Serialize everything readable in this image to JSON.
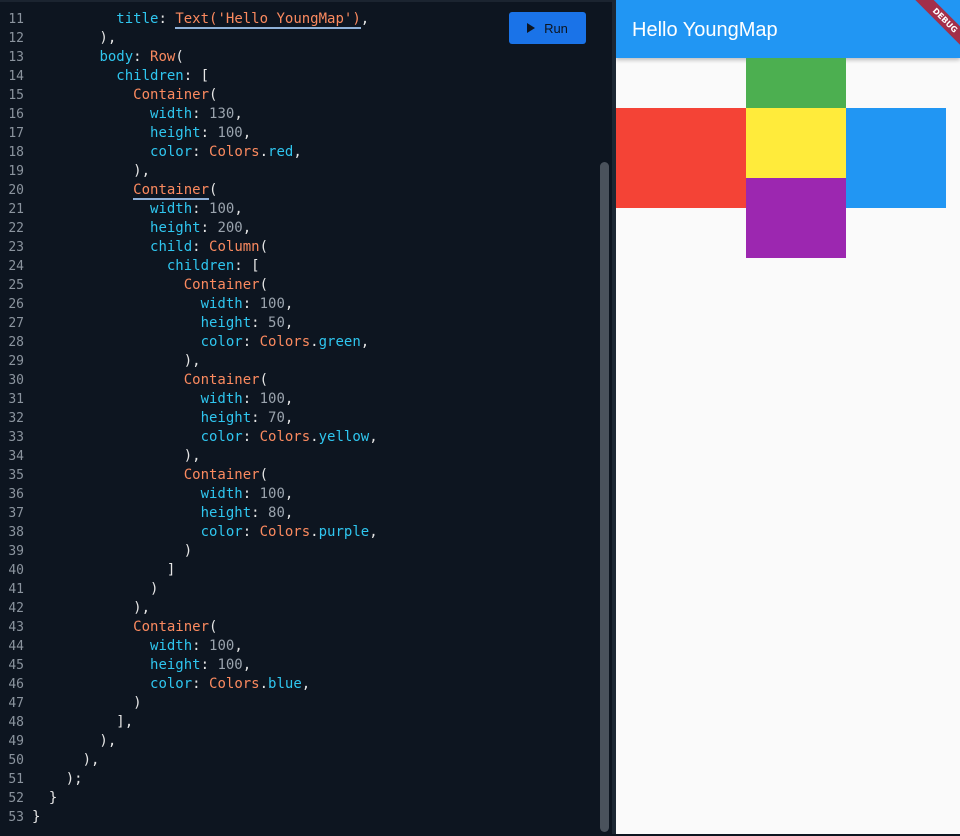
{
  "editor": {
    "run_label": "Run",
    "lines": [
      {
        "n": "11",
        "tokens": [
          [
            "          ",
            "t-id"
          ],
          [
            "title",
            "t-prop"
          ],
          [
            ": ",
            "t-punc"
          ],
          [
            "Text('Hello YoungMap')",
            "t-class"
          ],
          [
            ",",
            "t-punc"
          ]
        ]
      },
      {
        "n": "12",
        "tokens": [
          [
            "        ),",
            "t-punc"
          ]
        ]
      },
      {
        "n": "13",
        "tokens": [
          [
            "        ",
            "t-id"
          ],
          [
            "body",
            "t-prop"
          ],
          [
            ": ",
            "t-punc"
          ],
          [
            "Row",
            "t-class"
          ],
          [
            "(",
            "t-punc"
          ]
        ]
      },
      {
        "n": "14",
        "tokens": [
          [
            "          ",
            "t-id"
          ],
          [
            "children",
            "t-prop"
          ],
          [
            ": [",
            "t-punc"
          ]
        ]
      },
      {
        "n": "15",
        "tokens": [
          [
            "            ",
            "t-id"
          ],
          [
            "Container",
            "t-class"
          ],
          [
            "(",
            "t-punc"
          ]
        ]
      },
      {
        "n": "16",
        "tokens": [
          [
            "              ",
            "t-id"
          ],
          [
            "width",
            "t-prop"
          ],
          [
            ": ",
            "t-punc"
          ],
          [
            "130",
            "t-num"
          ],
          [
            ",",
            "t-punc"
          ]
        ]
      },
      {
        "n": "17",
        "tokens": [
          [
            "              ",
            "t-id"
          ],
          [
            "height",
            "t-prop"
          ],
          [
            ": ",
            "t-punc"
          ],
          [
            "100",
            "t-num"
          ],
          [
            ",",
            "t-punc"
          ]
        ]
      },
      {
        "n": "18",
        "tokens": [
          [
            "              ",
            "t-id"
          ],
          [
            "color",
            "t-prop"
          ],
          [
            ": ",
            "t-punc"
          ],
          [
            "Colors",
            "t-class"
          ],
          [
            ".",
            "t-punc"
          ],
          [
            "red",
            "t-prop"
          ],
          [
            ",",
            "t-punc"
          ]
        ]
      },
      {
        "n": "19",
        "tokens": [
          [
            "            ),",
            "t-punc"
          ]
        ]
      },
      {
        "n": "20",
        "tokens": [
          [
            "            ",
            "t-id"
          ],
          [
            "Container",
            "t-class"
          ],
          [
            "(",
            "t-punc"
          ]
        ]
      },
      {
        "n": "21",
        "tokens": [
          [
            "              ",
            "t-id"
          ],
          [
            "width",
            "t-prop"
          ],
          [
            ": ",
            "t-punc"
          ],
          [
            "100",
            "t-num"
          ],
          [
            ",",
            "t-punc"
          ]
        ]
      },
      {
        "n": "22",
        "tokens": [
          [
            "              ",
            "t-id"
          ],
          [
            "height",
            "t-prop"
          ],
          [
            ": ",
            "t-punc"
          ],
          [
            "200",
            "t-num"
          ],
          [
            ",",
            "t-punc"
          ]
        ]
      },
      {
        "n": "23",
        "tokens": [
          [
            "              ",
            "t-id"
          ],
          [
            "child",
            "t-prop"
          ],
          [
            ": ",
            "t-punc"
          ],
          [
            "Column",
            "t-class"
          ],
          [
            "(",
            "t-punc"
          ]
        ]
      },
      {
        "n": "24",
        "tokens": [
          [
            "                ",
            "t-id"
          ],
          [
            "children",
            "t-prop"
          ],
          [
            ": [",
            "t-punc"
          ]
        ]
      },
      {
        "n": "25",
        "tokens": [
          [
            "                  ",
            "t-id"
          ],
          [
            "Container",
            "t-class"
          ],
          [
            "(",
            "t-punc"
          ]
        ]
      },
      {
        "n": "26",
        "tokens": [
          [
            "                    ",
            "t-id"
          ],
          [
            "width",
            "t-prop"
          ],
          [
            ": ",
            "t-punc"
          ],
          [
            "100",
            "t-num"
          ],
          [
            ",",
            "t-punc"
          ]
        ]
      },
      {
        "n": "27",
        "tokens": [
          [
            "                    ",
            "t-id"
          ],
          [
            "height",
            "t-prop"
          ],
          [
            ": ",
            "t-punc"
          ],
          [
            "50",
            "t-num"
          ],
          [
            ",",
            "t-punc"
          ]
        ]
      },
      {
        "n": "28",
        "tokens": [
          [
            "                    ",
            "t-id"
          ],
          [
            "color",
            "t-prop"
          ],
          [
            ": ",
            "t-punc"
          ],
          [
            "Colors",
            "t-class"
          ],
          [
            ".",
            "t-punc"
          ],
          [
            "green",
            "t-prop"
          ],
          [
            ",",
            "t-punc"
          ]
        ]
      },
      {
        "n": "29",
        "tokens": [
          [
            "                  ),",
            "t-punc"
          ]
        ]
      },
      {
        "n": "30",
        "tokens": [
          [
            "                  ",
            "t-id"
          ],
          [
            "Container",
            "t-class"
          ],
          [
            "(",
            "t-punc"
          ]
        ]
      },
      {
        "n": "31",
        "tokens": [
          [
            "                    ",
            "t-id"
          ],
          [
            "width",
            "t-prop"
          ],
          [
            ": ",
            "t-punc"
          ],
          [
            "100",
            "t-num"
          ],
          [
            ",",
            "t-punc"
          ]
        ]
      },
      {
        "n": "32",
        "tokens": [
          [
            "                    ",
            "t-id"
          ],
          [
            "height",
            "t-prop"
          ],
          [
            ": ",
            "t-punc"
          ],
          [
            "70",
            "t-num"
          ],
          [
            ",",
            "t-punc"
          ]
        ]
      },
      {
        "n": "33",
        "tokens": [
          [
            "                    ",
            "t-id"
          ],
          [
            "color",
            "t-prop"
          ],
          [
            ": ",
            "t-punc"
          ],
          [
            "Colors",
            "t-class"
          ],
          [
            ".",
            "t-punc"
          ],
          [
            "yellow",
            "t-prop"
          ],
          [
            ",",
            "t-punc"
          ]
        ]
      },
      {
        "n": "34",
        "tokens": [
          [
            "                  ),",
            "t-punc"
          ]
        ]
      },
      {
        "n": "35",
        "tokens": [
          [
            "                  ",
            "t-id"
          ],
          [
            "Container",
            "t-class"
          ],
          [
            "(",
            "t-punc"
          ]
        ]
      },
      {
        "n": "36",
        "tokens": [
          [
            "                    ",
            "t-id"
          ],
          [
            "width",
            "t-prop"
          ],
          [
            ": ",
            "t-punc"
          ],
          [
            "100",
            "t-num"
          ],
          [
            ",",
            "t-punc"
          ]
        ]
      },
      {
        "n": "37",
        "tokens": [
          [
            "                    ",
            "t-id"
          ],
          [
            "height",
            "t-prop"
          ],
          [
            ": ",
            "t-punc"
          ],
          [
            "80",
            "t-num"
          ],
          [
            ",",
            "t-punc"
          ]
        ]
      },
      {
        "n": "38",
        "tokens": [
          [
            "                    ",
            "t-id"
          ],
          [
            "color",
            "t-prop"
          ],
          [
            ": ",
            "t-punc"
          ],
          [
            "Colors",
            "t-class"
          ],
          [
            ".",
            "t-punc"
          ],
          [
            "purple",
            "t-prop"
          ],
          [
            ",",
            "t-punc"
          ]
        ]
      },
      {
        "n": "39",
        "tokens": [
          [
            "                  )",
            "t-punc"
          ]
        ]
      },
      {
        "n": "40",
        "tokens": [
          [
            "                ]",
            "t-punc"
          ]
        ]
      },
      {
        "n": "41",
        "tokens": [
          [
            "              )",
            "t-punc"
          ]
        ]
      },
      {
        "n": "42",
        "tokens": [
          [
            "            ),",
            "t-punc"
          ]
        ]
      },
      {
        "n": "43",
        "tokens": [
          [
            "            ",
            "t-id"
          ],
          [
            "Container",
            "t-class"
          ],
          [
            "(",
            "t-punc"
          ]
        ]
      },
      {
        "n": "44",
        "tokens": [
          [
            "              ",
            "t-id"
          ],
          [
            "width",
            "t-prop"
          ],
          [
            ": ",
            "t-punc"
          ],
          [
            "100",
            "t-num"
          ],
          [
            ",",
            "t-punc"
          ]
        ]
      },
      {
        "n": "45",
        "tokens": [
          [
            "              ",
            "t-id"
          ],
          [
            "height",
            "t-prop"
          ],
          [
            ": ",
            "t-punc"
          ],
          [
            "100",
            "t-num"
          ],
          [
            ",",
            "t-punc"
          ]
        ]
      },
      {
        "n": "46",
        "tokens": [
          [
            "              ",
            "t-id"
          ],
          [
            "color",
            "t-prop"
          ],
          [
            ": ",
            "t-punc"
          ],
          [
            "Colors",
            "t-class"
          ],
          [
            ".",
            "t-punc"
          ],
          [
            "blue",
            "t-prop"
          ],
          [
            ",",
            "t-punc"
          ]
        ]
      },
      {
        "n": "47",
        "tokens": [
          [
            "            )",
            "t-punc"
          ]
        ]
      },
      {
        "n": "48",
        "tokens": [
          [
            "          ],",
            "t-punc"
          ]
        ]
      },
      {
        "n": "49",
        "tokens": [
          [
            "        ),",
            "t-punc"
          ]
        ]
      },
      {
        "n": "50",
        "tokens": [
          [
            "      ),",
            "t-punc"
          ]
        ]
      },
      {
        "n": "51",
        "tokens": [
          [
            "    );",
            "t-punc"
          ]
        ]
      },
      {
        "n": "52",
        "tokens": [
          [
            "  }",
            "t-punc"
          ]
        ]
      },
      {
        "n": "53",
        "tokens": [
          [
            "}",
            "t-punc"
          ]
        ]
      }
    ]
  },
  "preview": {
    "app_title": "Hello YoungMap",
    "debug_label": "DEBUG",
    "colors": {
      "appbar": "#2196f3",
      "red": "#f44336",
      "green": "#4caf50",
      "yellow": "#ffeb3b",
      "purple": "#9c27b0",
      "blue": "#2196f3"
    }
  }
}
